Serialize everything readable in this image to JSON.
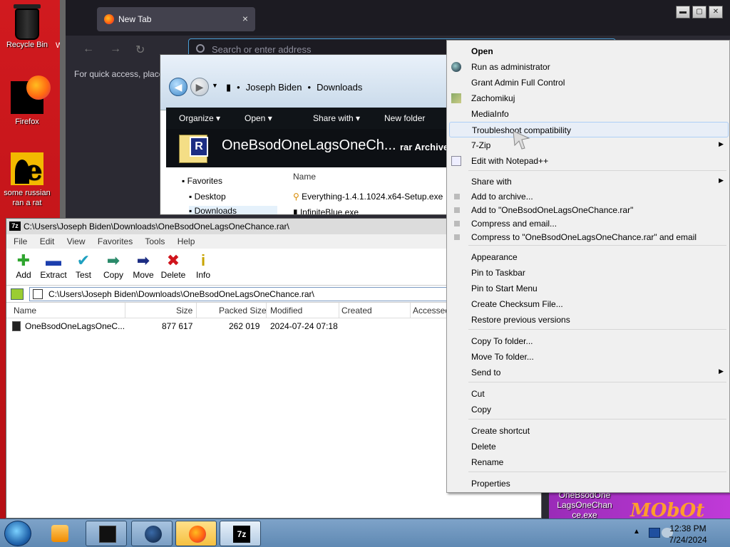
{
  "desktop": {
    "icons": [
      {
        "label": "Recycle Bin"
      },
      {
        "label": "Firefox"
      },
      {
        "label": "some russian ran a rat"
      }
    ],
    "edge_letter": "W"
  },
  "browser": {
    "tab_title": "New Tab",
    "tab_close": "×",
    "url_placeholder": "Search or enter address",
    "quick_access_text": "For quick access, place",
    "back": "←",
    "forward": "→",
    "reload": "↻",
    "window_buttons": [
      "▬",
      "▢",
      "✕"
    ]
  },
  "explorer": {
    "breadcrumb": [
      "Joseph Biden",
      "Downloads"
    ],
    "commands": [
      "Organize ▾",
      "Open ▾",
      "Share with ▾",
      "New folder"
    ],
    "preview_title": "OneBsodOneLagsOneCh...",
    "preview_type": "rar Archive",
    "nav": [
      "Favorites",
      "Desktop",
      "Downloads"
    ],
    "column_name": "Name",
    "files": [
      "Everything-1.4.1.1024.x64-Setup.exe",
      "InfiniteBlue.exe"
    ]
  },
  "sevenzip": {
    "title": "C:\\Users\\Joseph Biden\\Downloads\\OneBsodOneLagsOneChance.rar\\",
    "title_icon": "7z",
    "menu": [
      "File",
      "Edit",
      "View",
      "Favorites",
      "Tools",
      "Help"
    ],
    "toolbar": [
      {
        "label": "Add",
        "icon": "add-icon",
        "glyph": "✚",
        "color": "#2fa52f"
      },
      {
        "label": "Extract",
        "icon": "extract-icon",
        "glyph": "▬",
        "color": "#1c3fae"
      },
      {
        "label": "Test",
        "icon": "test-icon",
        "glyph": "✔",
        "color": "#1fa0c0"
      },
      {
        "label": "Copy",
        "icon": "copy-icon",
        "glyph": "➡",
        "color": "#2a8a6a"
      },
      {
        "label": "Move",
        "icon": "move-icon",
        "glyph": "➡",
        "color": "#1c2d83"
      },
      {
        "label": "Delete",
        "icon": "delete-icon",
        "glyph": "✖",
        "color": "#d0141c"
      },
      {
        "label": "Info",
        "icon": "info-icon",
        "glyph": "i",
        "color": "#c8a400"
      }
    ],
    "path": "C:\\Users\\Joseph Biden\\Downloads\\OneBsodOneLagsOneChance.rar\\",
    "columns": [
      "Name",
      "Size",
      "Packed Size",
      "Modified",
      "Created",
      "Accessed"
    ],
    "rows": [
      {
        "name": "OneBsodOneLagsOneC...",
        "size": "877 617",
        "packed": "262 019",
        "modified": "2024-07-24 07:18"
      }
    ]
  },
  "context_menu": {
    "items": [
      {
        "label": "Open",
        "bold": true
      },
      {
        "label": "Run as administrator",
        "icon": "shield-globe-icon"
      },
      {
        "label": "Grant Admin Full Control"
      },
      {
        "label": "Zachomikuj",
        "icon": "hamster-icon"
      },
      {
        "label": "MediaInfo"
      },
      {
        "label": "Troubleshoot compatibility",
        "highlighted": true
      },
      {
        "label": "7-Zip",
        "submenu": true
      },
      {
        "label": "Edit with Notepad++",
        "icon": "notepad-plus-icon"
      },
      {
        "label": "Share with",
        "submenu": true
      },
      {
        "label": "Add to archive...",
        "icon": "winrar-icon"
      },
      {
        "label": "Add to \"OneBsodOneLagsOneChance.rar\"",
        "icon": "winrar-icon"
      },
      {
        "label": "Compress and email...",
        "icon": "winrar-icon"
      },
      {
        "label": "Compress to \"OneBsodOneLagsOneChance.rar\" and email",
        "icon": "winrar-icon"
      },
      {
        "label": "Appearance"
      },
      {
        "label": "Pin to Taskbar"
      },
      {
        "label": "Pin to Start Menu"
      },
      {
        "label": "Create Checksum File..."
      },
      {
        "label": "Restore previous versions"
      },
      {
        "label": "Copy To folder..."
      },
      {
        "label": "Move To folder..."
      },
      {
        "label": "Send to",
        "submenu": true
      },
      {
        "label": "Cut"
      },
      {
        "label": "Copy"
      },
      {
        "label": "Create shortcut"
      },
      {
        "label": "Delete"
      },
      {
        "label": "Rename"
      },
      {
        "label": "Properties"
      }
    ],
    "submenu_arrow": "▶"
  },
  "wallpaper": {
    "icon_label": "OneBsodOne LagsOneChan ce.exe",
    "brand": "MObOt"
  },
  "taskbar": {
    "time": "12:38 PM",
    "date": "7/24/2024",
    "items": [
      {
        "name": "media-player-icon"
      },
      {
        "name": "black-cube-icon"
      },
      {
        "name": "globe-icon"
      },
      {
        "name": "firefox-icon"
      },
      {
        "name": "seven-zip-icon",
        "label": "7z"
      }
    ]
  }
}
